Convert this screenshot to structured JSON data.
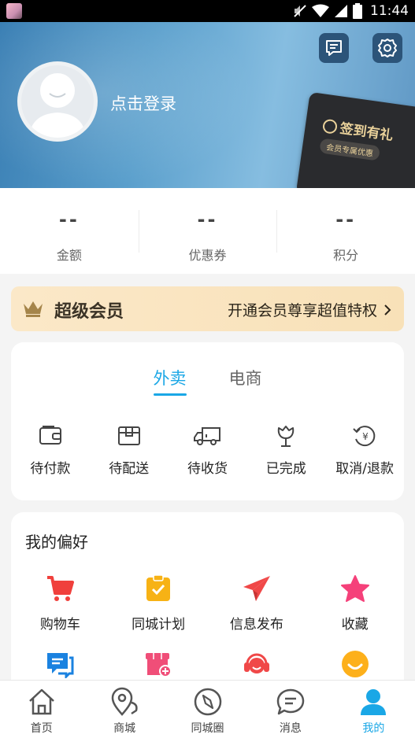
{
  "status_bar": {
    "time": "11:44",
    "icons": [
      "app-thumbnail-icon",
      "mute-icon",
      "wifi-icon",
      "signal-icon",
      "battery-icon"
    ]
  },
  "header": {
    "message_icon": "message-icon",
    "settings_icon": "settings-icon",
    "login_label": "点击登录",
    "checkin_card": {
      "title": "签到有礼",
      "subtitle": "会员专属优惠"
    }
  },
  "stats": [
    {
      "value": "--",
      "label": "金额"
    },
    {
      "value": "--",
      "label": "优惠券"
    },
    {
      "value": "--",
      "label": "积分"
    }
  ],
  "vip": {
    "title": "超级会员",
    "cta": "开通会员尊享超值特权"
  },
  "orders": {
    "tabs": [
      {
        "label": "外卖",
        "active": true
      },
      {
        "label": "电商",
        "active": false
      }
    ],
    "items": [
      {
        "label": "待付款",
        "icon": "wallet-icon"
      },
      {
        "label": "待配送",
        "icon": "package-icon"
      },
      {
        "label": "待收货",
        "icon": "delivery-truck-icon"
      },
      {
        "label": "已完成",
        "icon": "flower-icon"
      },
      {
        "label": "取消/退款",
        "icon": "refund-icon"
      }
    ]
  },
  "preferences": {
    "title": "我的偏好",
    "items": [
      {
        "label": "购物车",
        "icon": "shopping-cart-icon"
      },
      {
        "label": "同城计划",
        "icon": "clipboard-check-icon"
      },
      {
        "label": "信息发布",
        "icon": "paper-plane-icon"
      },
      {
        "label": "收藏",
        "icon": "star-icon"
      },
      {
        "label": "",
        "icon": "chat-icon"
      },
      {
        "label": "",
        "icon": "shop-add-icon"
      },
      {
        "label": "",
        "icon": "customer-service-icon"
      },
      {
        "label": "",
        "icon": "smile-icon"
      }
    ]
  },
  "bottom_nav": [
    {
      "label": "首页",
      "icon": "home-icon",
      "active": false
    },
    {
      "label": "商城",
      "icon": "location-pin-icon",
      "active": false
    },
    {
      "label": "同城圈",
      "icon": "compass-icon",
      "active": false
    },
    {
      "label": "消息",
      "icon": "message-bubble-icon",
      "active": false
    },
    {
      "label": "我的",
      "icon": "user-icon",
      "active": true
    }
  ],
  "colors": {
    "accent": "#1aa7e6",
    "cart_red": "#f0403c",
    "plan_yellow": "#f7b215",
    "send_red": "#f04848",
    "star_pink": "#f5417a",
    "chat_blue": "#1a82e0",
    "shop_pink": "#f04e78",
    "smile_orange": "#fdb01b",
    "vip_bg": "#fbe8c8"
  }
}
